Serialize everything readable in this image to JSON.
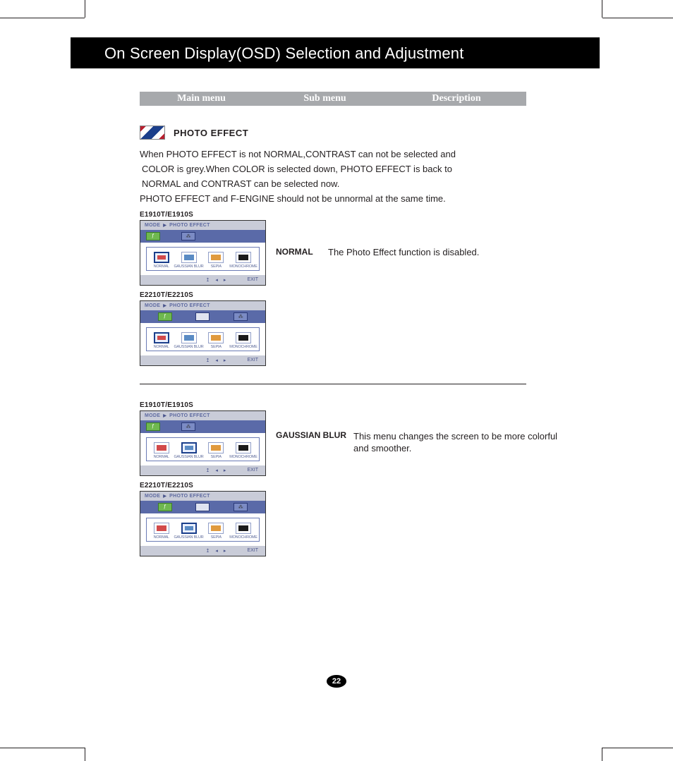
{
  "header": {
    "title": "On Screen Display(OSD) Selection and Adjustment"
  },
  "column_bar": {
    "c1": "Main menu",
    "c2": "Sub menu",
    "c3": "Description"
  },
  "section": {
    "label": "PHOTO EFFECT",
    "para1": "When PHOTO EFFECT is not NORMAL,CONTRAST can not be selected and",
    "para2": " COLOR is grey.When COLOR is selected down, PHOTO EFFECT is back to",
    "para3": " NORMAL and CONTRAST can be selected now.",
    "para4": "PHOTO EFFECT and F-ENGINE should not be unnormal at the same time."
  },
  "models": {
    "a": "E1910T/E1910S",
    "b": "E2210T/E2210S"
  },
  "osd": {
    "mode": "MODE",
    "title": "PHOTO EFFECT",
    "items": [
      {
        "label": "NORMAL"
      },
      {
        "label": "GAUSSIAN BLUR"
      },
      {
        "label": "SEPIA"
      },
      {
        "label": "MONOCHROME"
      }
    ],
    "exit": "EXIT"
  },
  "normal": {
    "submenu": "NORMAL",
    "desc": "The Photo Effect function is disabled."
  },
  "gaussian": {
    "submenu": "GAUSSIAN BLUR",
    "desc": "This menu changes the screen to be more colorful and smoother."
  },
  "page_number": "22"
}
